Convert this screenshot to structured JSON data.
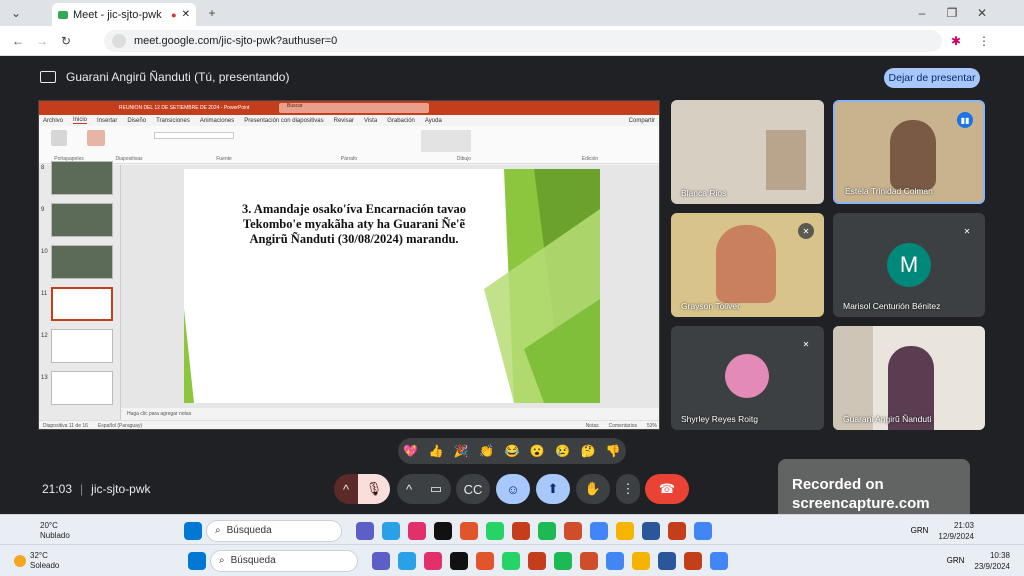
{
  "browser": {
    "tab_title": "Meet - jic-sjto-pwk",
    "url": "meet.google.com/jic-sjto-pwk?authuser=0"
  },
  "meet": {
    "presenting_label": "Guarani Angirũ Ñanduti (Tú, presentando)",
    "stop_presenting": "Dejar de presentar",
    "time": "21:03",
    "meeting_code": "jic-sjto-pwk",
    "participants": [
      {
        "name": "Blanca Rios"
      },
      {
        "name": "Estela Trinidad Colman"
      },
      {
        "name": "Grayson Toliver"
      },
      {
        "name": "Marisol Centurión Bénitez",
        "initial": "M"
      },
      {
        "name": "Shyrley Reyes Roitg"
      },
      {
        "name": "Guarani Angirũ Ñanduti"
      }
    ],
    "reactions": [
      "💖",
      "👍",
      "🎉",
      "👏",
      "😂",
      "😮",
      "😢",
      "🤔",
      "👎"
    ]
  },
  "powerpoint": {
    "title_bar": "REUNION DEL 12 DE SETIEMBRE DE 2024 - PowerPoint",
    "search": "Buscar",
    "menu": [
      "Archivo",
      "Inicio",
      "Insertar",
      "Diseño",
      "Transiciones",
      "Animaciones",
      "Presentación con diapositivas",
      "Revisar",
      "Vista",
      "Grabación",
      "Ayuda"
    ],
    "share": "Compartir",
    "ribbon_groups": [
      "Portapapeles",
      "Diapositivas",
      "Fuente",
      "Párrafo",
      "Dibujo",
      "Edición"
    ],
    "slide_numbers": [
      "8",
      "9",
      "10",
      "11",
      "12",
      "13"
    ],
    "slide_title": "3. Amandaje osako'íva Encarnación tavao Tekombo'e myakãha aty ha Guarani Ñe'ẽ Angirũ Ñanduti (30/08/2024) marandu.",
    "notes_placeholder": "Haga clic para agregar notas",
    "status_slide": "Diapositiva 11 de 16",
    "status_lang": "Español (Paraguay)",
    "status_notes": "Notas",
    "status_comments": "Comentarios",
    "zoom": "53%"
  },
  "watermark": {
    "line1": "Recorded on",
    "line2": "screencapture.com"
  },
  "taskbar_inner": {
    "temp": "20°C",
    "weather": "Nublado",
    "search": "Búsqueda",
    "lang": "GRN",
    "time": "21:03",
    "date": "12/9/2024"
  },
  "taskbar_outer": {
    "temp": "32°C",
    "weather": "Soleado",
    "search": "Búsqueda",
    "lang": "GRN",
    "time": "10:38",
    "date": "23/9/2024"
  },
  "colors": {
    "accent": "#a8c7fa",
    "end_call": "#ea4335",
    "ppt": "#c43e1c",
    "green": "#8cc63f"
  }
}
